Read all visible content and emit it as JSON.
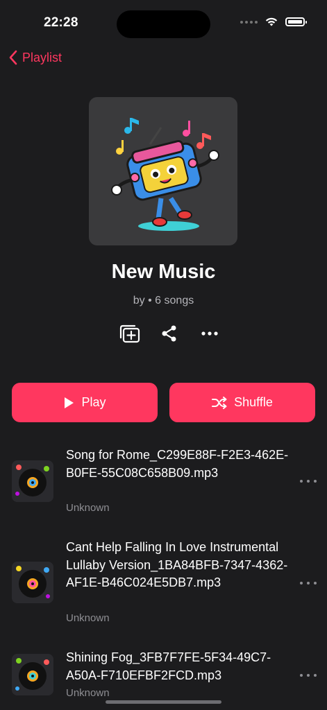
{
  "status_bar": {
    "time": "22:28"
  },
  "nav": {
    "back_label": "Playlist"
  },
  "playlist": {
    "title": "New Music",
    "subtitle": "by  • 6 songs"
  },
  "buttons": {
    "play_label": "Play",
    "shuffle_label": "Shuffle"
  },
  "songs": [
    {
      "title": "Song for Rome_C299E88F-F2E3-462E-B0FE-55C08C658B09.mp3",
      "artist": "Unknown"
    },
    {
      "title": "Cant Help Falling In Love Instrumental Lullaby Version_1BA84BFB-7347-4362-AF1E-B46C024E5DB7.mp3",
      "artist": "Unknown"
    },
    {
      "title": "Shining Fog_3FB7F7FE-5F34-49C7-A50A-F710EFBF2FCD.mp3",
      "artist": "Unknown"
    }
  ],
  "colors": {
    "accent": "#ff375f",
    "background": "#1c1c1e",
    "secondary_text": "#8e8e93"
  }
}
